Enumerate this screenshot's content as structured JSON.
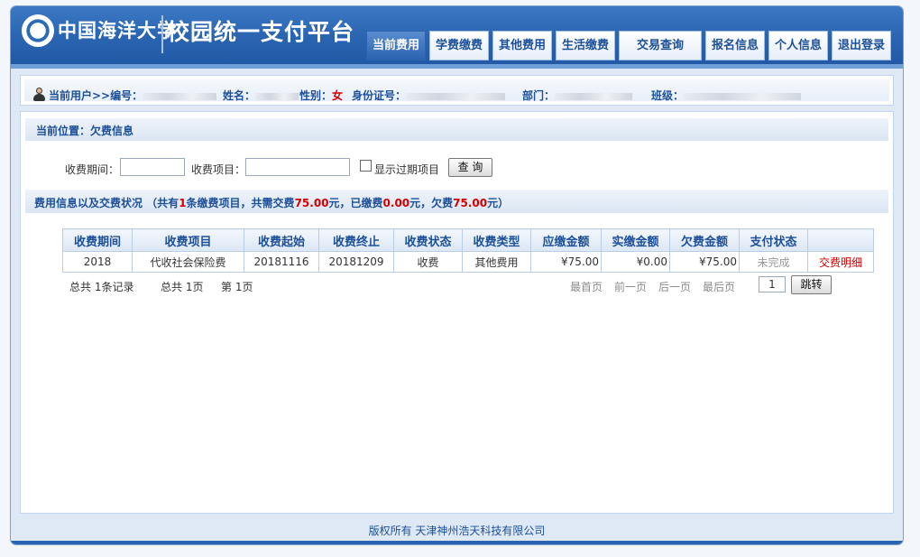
{
  "header": {
    "university_name": "中国海洋大学",
    "platform_title": "校园统一支付平台"
  },
  "nav": {
    "tabs": [
      {
        "label": "当前费用",
        "active": true
      },
      {
        "label": "学费缴费",
        "active": false
      },
      {
        "label": "其他费用",
        "active": false
      },
      {
        "label": "生活缴费",
        "active": false
      },
      {
        "label": "交易查询",
        "active": false
      },
      {
        "label": "报名信息",
        "active": false
      },
      {
        "label": "个人信息",
        "active": false
      },
      {
        "label": "退出登录",
        "active": false
      }
    ]
  },
  "user": {
    "prefix": "当前用户>>编号：",
    "name_label": "姓名：",
    "gender_label": "性别：",
    "gender_value": "女",
    "id_label": "身份证号：",
    "dept_label": "部门：",
    "class_label": "班级："
  },
  "location": {
    "text": "当前位置：欠费信息"
  },
  "search": {
    "period_label": "收费期间：",
    "period_value": "",
    "item_label": "收费项目：",
    "item_value": "",
    "show_expired_label": "显示过期项目",
    "show_expired_checked": false,
    "query_button": "查 询"
  },
  "summary": {
    "part1": "费用信息以及交费状况 （共有",
    "count": "1",
    "part2": "条缴费项目，共需交费",
    "total_due": "75.00",
    "part3": "元，已缴费",
    "paid": "0.00",
    "part4": "元，欠费",
    "owed": "75.00",
    "part5": "元）"
  },
  "table": {
    "headers": [
      "收费期间",
      "收费项目",
      "收费起始",
      "收费终止",
      "收费状态",
      "收费类型",
      "应缴金额",
      "实缴金额",
      "欠费金额",
      "支付状态",
      ""
    ],
    "rows": [
      {
        "period": "2018",
        "item": "代收社会保险费",
        "start": "20181116",
        "end": "20181209",
        "status": "收费",
        "type": "其他费用",
        "due": "¥75.00",
        "paid": "¥0.00",
        "owed": "¥75.00",
        "pay_status": "未完成",
        "action": "交费明细"
      }
    ]
  },
  "pager": {
    "total_records": "总共  1条记录",
    "total_pages": "总共  1页",
    "current_page": "第 1页",
    "first": "最首页",
    "prev": "前一页",
    "next": "后一页",
    "last": "最后页",
    "page_value": "1",
    "jump_button": "跳转"
  },
  "footer": {
    "copyright": "版权所有 天津神州浩天科技有限公司"
  }
}
